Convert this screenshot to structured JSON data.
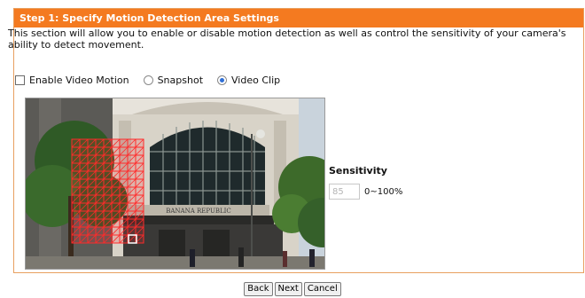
{
  "header": {
    "title": "Step 1: Specify Motion Detection Area Settings"
  },
  "description": "This section will allow you to enable or disable motion detection as well as control the sensitivity of your camera's ability to detect movement.",
  "options": {
    "enable_label": "Enable Video Motion",
    "snapshot_label": "Snapshot",
    "videoclip_label": "Video Clip",
    "enable_checked": false,
    "selected": "Video Clip"
  },
  "sensitivity": {
    "title": "Sensitivity",
    "value": "85",
    "range_label": "0~100%"
  },
  "camera": {
    "building_sign": "BANANA REPUBLIC",
    "grid_color": "#ff2a2a"
  },
  "buttons": {
    "back": "Back",
    "next": "Next",
    "cancel": "Cancel"
  },
  "colors": {
    "header_bg": "#f47a20",
    "radio_selected": "#2f6fd6"
  }
}
